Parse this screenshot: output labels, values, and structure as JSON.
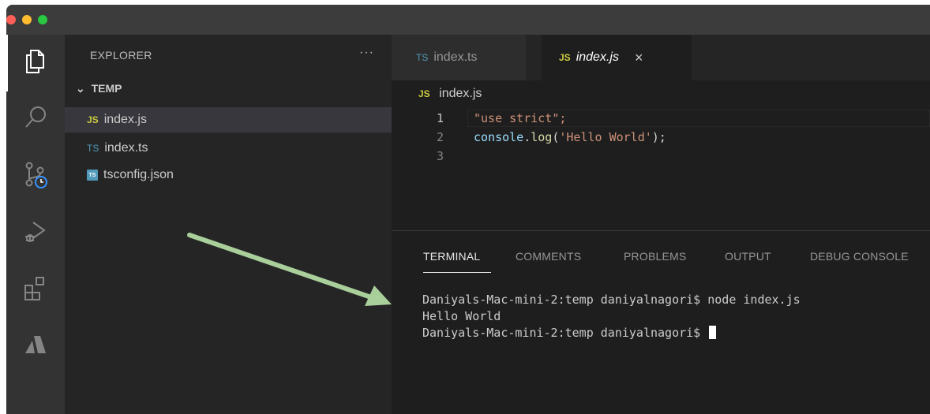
{
  "sidebar": {
    "title": "EXPLORER",
    "more": "···",
    "folder": "TEMP",
    "files": [
      {
        "icon": "JS",
        "name": "index.js"
      },
      {
        "icon": "TS",
        "name": "index.ts"
      },
      {
        "icon": "TS",
        "name": "tsconfig.json"
      }
    ]
  },
  "tabs": [
    {
      "icon": "TS",
      "label": "index.ts"
    },
    {
      "icon": "JS",
      "label": "index.js",
      "close": "×"
    }
  ],
  "breadcrumb": {
    "icon": "JS",
    "label": "index.js"
  },
  "code": {
    "line_numbers": [
      "1",
      "2",
      "3"
    ],
    "line1": "\"use strict\";",
    "line2_obj": "console",
    "line2_dot": ".",
    "line2_fn": "log",
    "line2_open": "(",
    "line2_str": "'Hello World'",
    "line2_close": ");"
  },
  "panel": {
    "tabs": [
      "TERMINAL",
      "COMMENTS",
      "PROBLEMS",
      "OUTPUT",
      "DEBUG CONSOLE"
    ],
    "terminal_lines": [
      "Daniyals-Mac-mini-2:temp daniyalnagori$ node index.js",
      "Hello World",
      "Daniyals-Mac-mini-2:temp daniyalnagori$ "
    ]
  },
  "colors": {
    "arrow": "#a9cf9a",
    "js_icon": "#cbcb41",
    "ts_icon": "#519aba"
  }
}
